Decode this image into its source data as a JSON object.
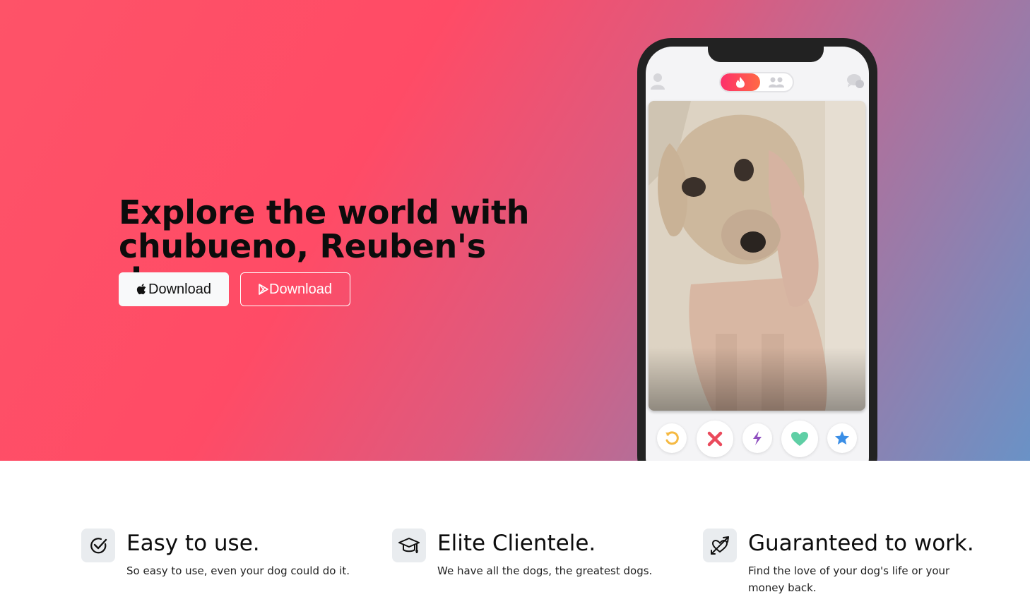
{
  "hero": {
    "headline": "Explore the world with chubueno, Reuben's dog.",
    "buttons": {
      "apple_download": "Download",
      "play_download": "Download"
    },
    "colors": {
      "gradient_start": "#fe5368",
      "gradient_mid": "#ff4b66",
      "gradient_end": "#6a92c6"
    }
  },
  "phone": {
    "top_icons": [
      "profile-icon",
      "flame-icon",
      "group-icon",
      "chat-icon"
    ],
    "toggle_active": "flame",
    "card_image": "dog photo",
    "action_buttons": [
      "rewind-icon",
      "nope-icon",
      "boost-icon",
      "like-icon",
      "super-like-icon"
    ]
  },
  "features": [
    {
      "icon": "check-circle-icon",
      "title": "Easy to use.",
      "description": "So easy to use, even your dog could do it."
    },
    {
      "icon": "graduation-cap-icon",
      "title": "Elite Clientele.",
      "description": "We have all the dogs, the greatest dogs."
    },
    {
      "icon": "heart-arrow-icon",
      "title": "Guaranteed to work.",
      "description": "Find the love of your dog's life or your money back."
    }
  ]
}
